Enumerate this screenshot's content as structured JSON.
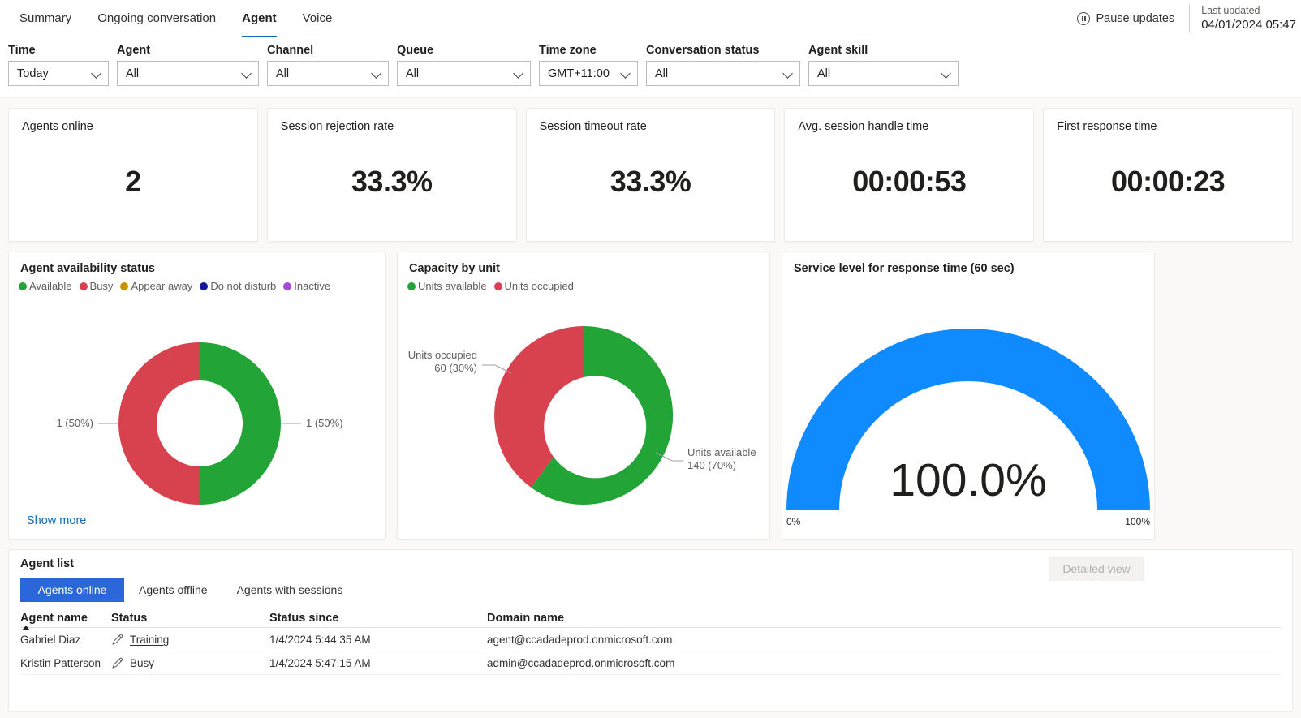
{
  "header": {
    "tabs": [
      {
        "label": "Summary",
        "active": false
      },
      {
        "label": "Ongoing conversation",
        "active": false
      },
      {
        "label": "Agent",
        "active": true
      },
      {
        "label": "Voice",
        "active": false
      }
    ],
    "pause_label": "Pause updates",
    "pause_icon": "pause-circle-icon",
    "last_updated_label": "Last updated",
    "last_updated_value": "04/01/2024 05:47"
  },
  "filters": [
    {
      "name": "time",
      "label": "Time",
      "value": "Today"
    },
    {
      "name": "agent",
      "label": "Agent",
      "value": "All"
    },
    {
      "name": "channel",
      "label": "Channel",
      "value": "All"
    },
    {
      "name": "queue",
      "label": "Queue",
      "value": "All"
    },
    {
      "name": "timezone",
      "label": "Time zone",
      "value": "GMT+11:00"
    },
    {
      "name": "conversation-status",
      "label": "Conversation status",
      "value": "All"
    },
    {
      "name": "agent-skill",
      "label": "Agent skill",
      "value": "All"
    }
  ],
  "kpis": [
    {
      "name": "agents-online",
      "title": "Agents online",
      "value": "2"
    },
    {
      "name": "session-rejection-rate",
      "title": "Session rejection rate",
      "value": "33.3%"
    },
    {
      "name": "session-timeout-rate",
      "title": "Session timeout rate",
      "value": "33.3%"
    },
    {
      "name": "avg-session-handle-time",
      "title": "Avg. session handle time",
      "value": "00:00:53"
    },
    {
      "name": "first-response-time",
      "title": "First response time",
      "value": "00:00:23"
    }
  ],
  "availability": {
    "title": "Agent availability status",
    "legend": [
      {
        "label": "Available",
        "color": "#22a437"
      },
      {
        "label": "Busy",
        "color": "#d8424f"
      },
      {
        "label": "Appear away",
        "color": "#c49300"
      },
      {
        "label": "Do not disturb",
        "color": "#15179e"
      },
      {
        "label": "Inactive",
        "color": "#a44ad8"
      }
    ],
    "label_left": "1 (50%)",
    "label_right": "1 (50%)",
    "show_more": "Show more"
  },
  "capacity": {
    "title": "Capacity by unit",
    "legend": [
      {
        "label": "Units available",
        "color": "#22a437"
      },
      {
        "label": "Units occupied",
        "color": "#d8424f"
      }
    ],
    "label_occupied_line1": "Units occupied",
    "label_occupied_line2": "60 (30%)",
    "label_available_line1": "Units available",
    "label_available_line2": "140 (70%)"
  },
  "service_level": {
    "title": "Service level for response time (60 sec)",
    "value": "100.0%",
    "axis_min": "0%",
    "axis_max": "100%",
    "color": "#0f8aff"
  },
  "agent_list": {
    "title": "Agent list",
    "pivots": [
      {
        "label": "Agents online",
        "selected": true
      },
      {
        "label": "Agents offline",
        "selected": false
      },
      {
        "label": "Agents with sessions",
        "selected": false
      }
    ],
    "detailed_view": "Detailed view",
    "columns": [
      "Agent name",
      "Status",
      "Status since",
      "Domain name"
    ],
    "rows": [
      {
        "agent_name": "Gabriel Diaz",
        "status": "Training",
        "status_since": "1/4/2024 5:44:35 AM",
        "domain_name": "agent@ccadadeprod.onmicrosoft.com"
      },
      {
        "agent_name": "Kristin Patterson",
        "status": "Busy",
        "status_since": "1/4/2024 5:47:15 AM",
        "domain_name": "admin@ccadadeprod.onmicrosoft.com"
      }
    ]
  },
  "chart_data": [
    {
      "type": "pie",
      "name": "agent-availability-status",
      "title": "Agent availability status",
      "labels": [
        "Available",
        "Busy",
        "Appear away",
        "Do not disturb",
        "Inactive"
      ],
      "values": [
        1,
        1,
        0,
        0,
        0
      ],
      "percents": [
        50,
        50,
        0,
        0,
        0
      ],
      "colors": [
        "#22a437",
        "#d8424f",
        "#c49300",
        "#15179e",
        "#a44ad8"
      ],
      "data_labels": [
        "1 (50%)",
        "1 (50%)"
      ],
      "legend": "top",
      "donut": true
    },
    {
      "type": "pie",
      "name": "capacity-by-unit",
      "title": "Capacity by unit",
      "labels": [
        "Units available",
        "Units occupied"
      ],
      "values": [
        140,
        60
      ],
      "percents": [
        70,
        30
      ],
      "colors": [
        "#22a437",
        "#d8424f"
      ],
      "data_labels": [
        "Units available 140 (70%)",
        "Units occupied 60 (30%)"
      ],
      "legend": "top",
      "donut": true
    },
    {
      "type": "bar",
      "name": "service-level-response-time",
      "title": "Service level for response time (60 sec)",
      "categories": [
        "Service level"
      ],
      "values": [
        100.0
      ],
      "value_label": "100.0%",
      "ylim": [
        0,
        100
      ],
      "xlabel": "",
      "ylabel": "",
      "tick_labels": [
        "0%",
        "100%"
      ],
      "gauge": true,
      "color": "#0f8aff"
    }
  ]
}
